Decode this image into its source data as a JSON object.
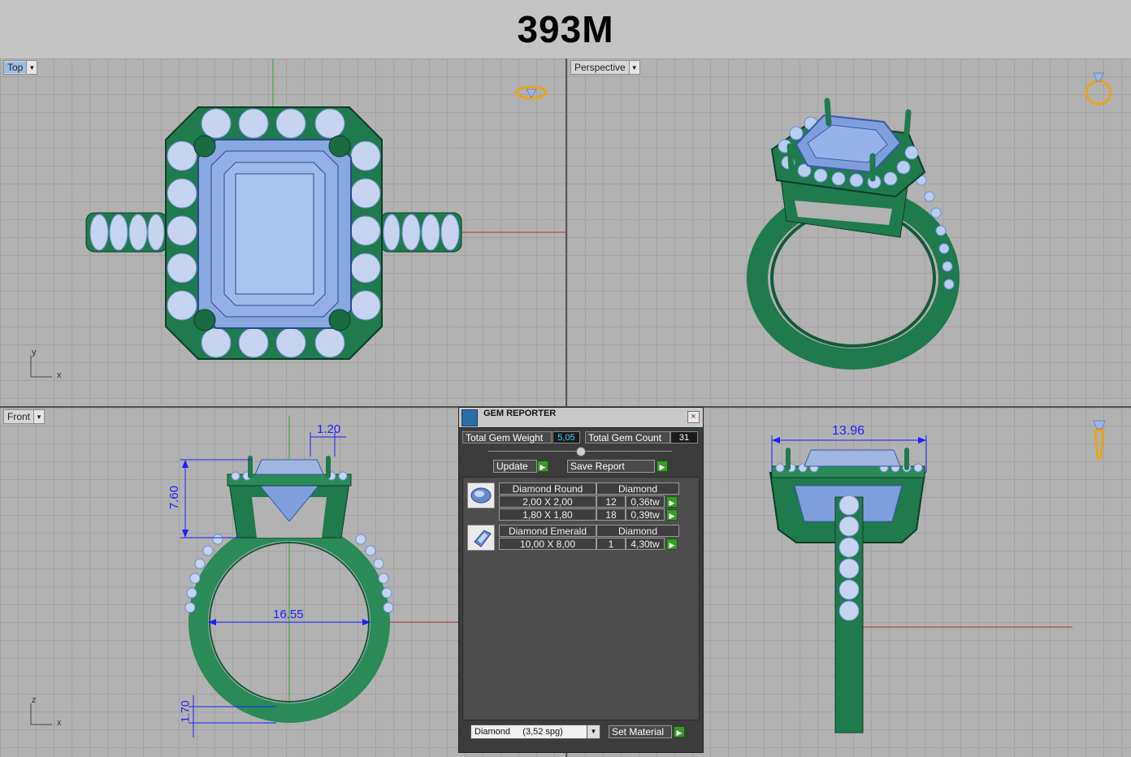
{
  "title": "393M",
  "viewports": {
    "top": {
      "label": "Top",
      "axis_y": "y",
      "axis_x": "x"
    },
    "perspective": {
      "label": "Perspective"
    },
    "front": {
      "label": "Front",
      "axis_z": "z",
      "axis_x": "x"
    },
    "right": {}
  },
  "dimensions": {
    "prong_width": "1.20",
    "head_height": "7.60",
    "inner_diameter": "16.55",
    "shank_thickness": "1.70",
    "halo_width": "13.96"
  },
  "gem_reporter": {
    "title": "GEM REPORTER",
    "close_glyph": "×",
    "total_weight_label": "Total Gem Weight",
    "total_weight_value": "5,05",
    "total_count_label": "Total Gem Count",
    "total_count_value": "31",
    "update_label": "Update",
    "save_report_label": "Save Report",
    "gems": [
      {
        "name": "Diamond Round",
        "material": "Diamond",
        "rows": [
          {
            "size": "2,00 X 2,00",
            "count": "12",
            "weight": "0,36tw"
          },
          {
            "size": "1,80 X 1,80",
            "count": "18",
            "weight": "0,39tw"
          }
        ]
      },
      {
        "name": "Diamond Emerald",
        "material": "Diamond",
        "rows": [
          {
            "size": "10,00 X 8,00",
            "count": "1",
            "weight": "4,30tw"
          }
        ]
      }
    ],
    "material_select": "Diamond     (3,52 spg)",
    "set_material_label": "Set Material"
  },
  "colors": {
    "metal": "#1f7a4d",
    "metal_dark": "#15583a",
    "gem": "#7f9fdc",
    "gem_light": "#b8cdf0",
    "dimension": "#1e1eff",
    "axis_red": "#b03030",
    "axis_green": "#3aa03a",
    "viewport_bg": "#b2b2b2"
  },
  "icons": [
    "ring-top-icon",
    "ring-perspective-icon",
    "ring-side-icon",
    "gem-reporter-icon",
    "dropdown-arrow-icon",
    "go-arrow-icon",
    "close-icon"
  ]
}
